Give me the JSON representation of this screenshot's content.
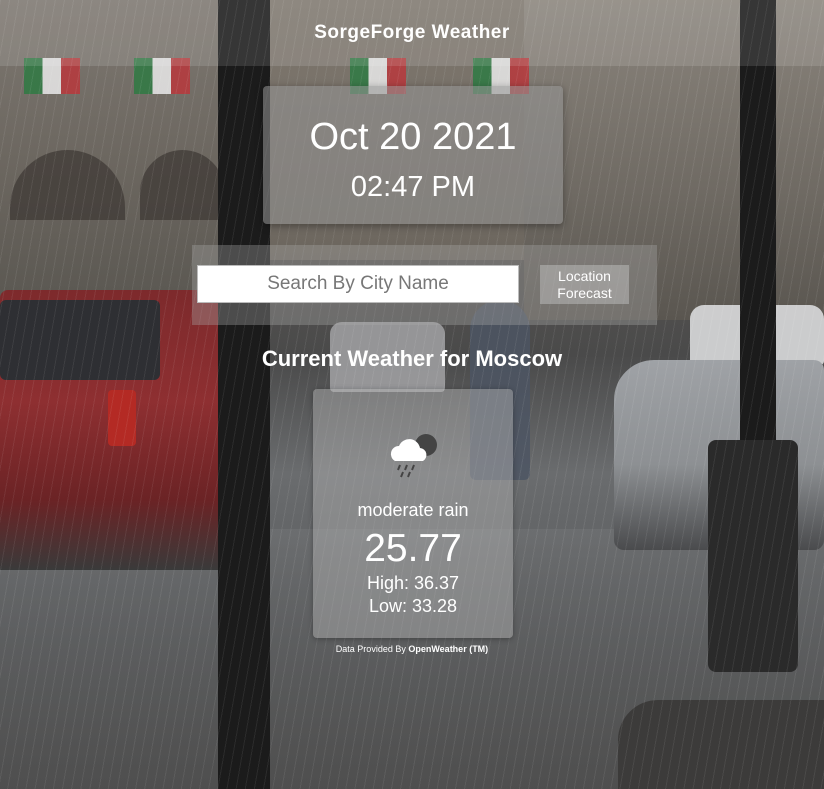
{
  "header": {
    "title": "SorgeForge Weather"
  },
  "datetime": {
    "date": "Oct 20 2021",
    "time": "02:47 PM"
  },
  "search": {
    "placeholder": "Search By City Name",
    "value": "",
    "forecast_button_line1": "Location",
    "forecast_button_line2": "Forecast"
  },
  "current": {
    "heading": "Current Weather for Moscow",
    "icon": "rain-cloud-icon",
    "description": "moderate rain",
    "temperature": "25.77",
    "high": "High: 36.37",
    "low": "Low: 33.28"
  },
  "credit": {
    "prefix": "Data Provided By ",
    "provider": "OpenWeather (TM)"
  }
}
